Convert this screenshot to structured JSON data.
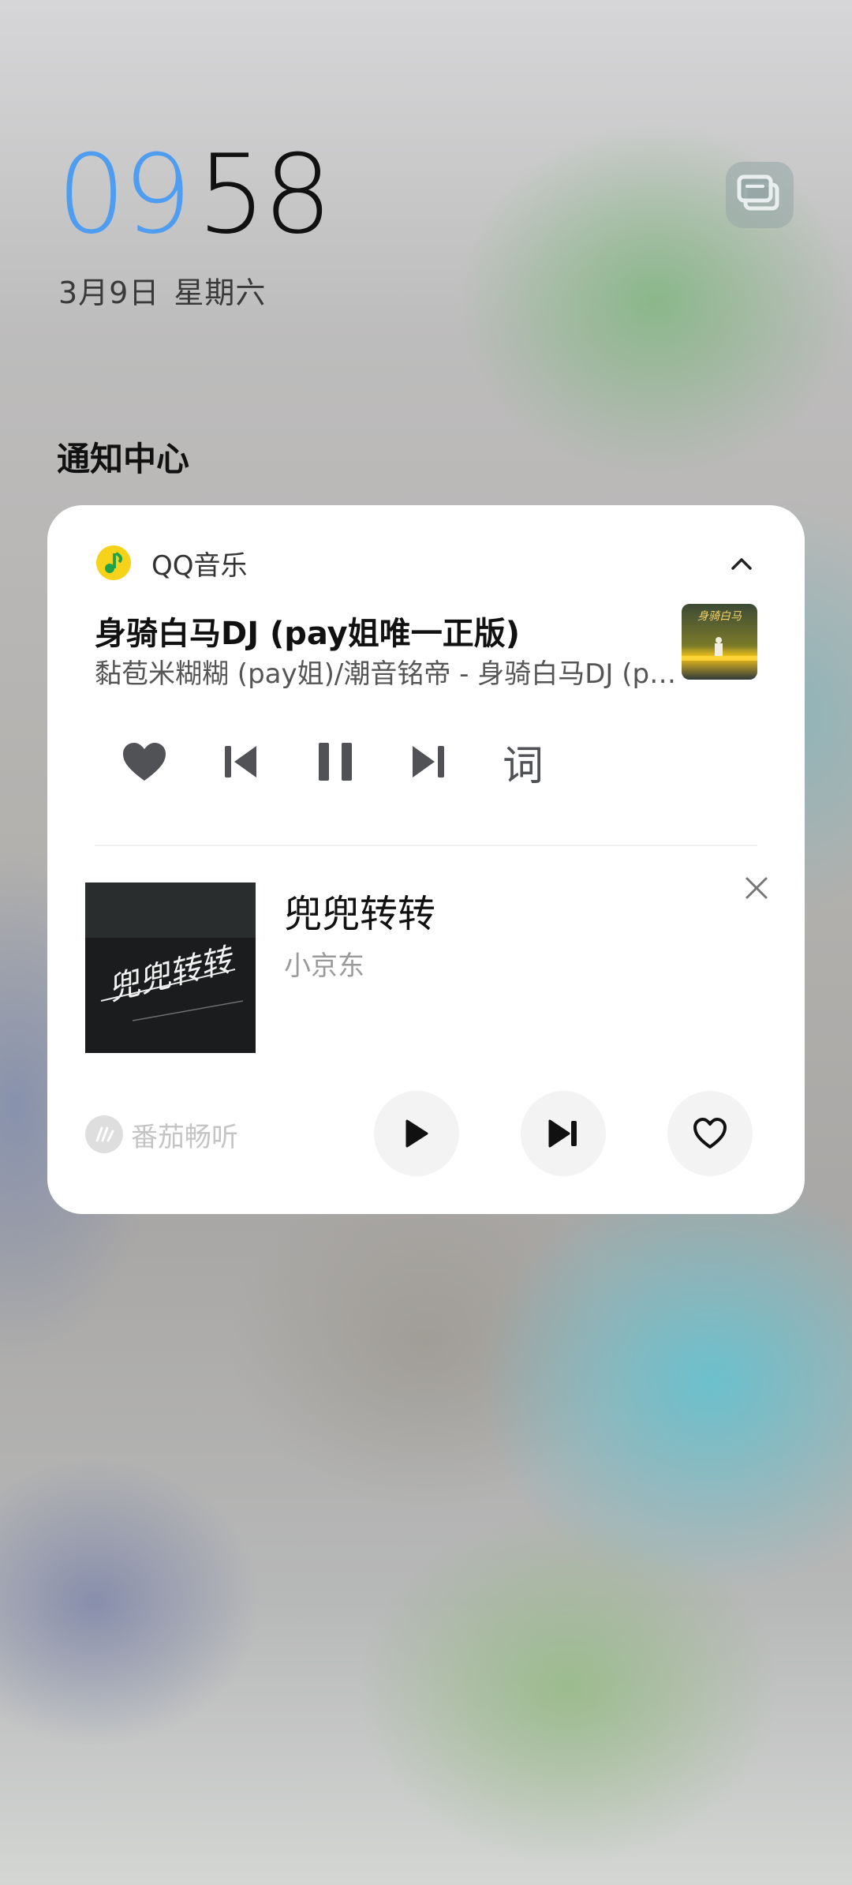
{
  "lockscreen": {
    "time_hour": "09",
    "time_minute": "58",
    "date": "3月9日",
    "weekday": "星期六"
  },
  "notification_center": {
    "title": "通知中心"
  },
  "qq_music": {
    "app_name": "QQ音乐",
    "song_title": "身骑白马DJ (pay姐唯一正版)",
    "song_subtitle": "黏苞米糊糊 (pay姐)/潮音铭帝 - 身骑白马DJ (pay姐唯一正版)",
    "lyrics_label": "词",
    "album_art_text": "身骑白马",
    "icons": {
      "app": "qq-music-note-icon",
      "collapse": "chevron-up-icon",
      "like": "heart-icon",
      "prev": "previous-track-icon",
      "pause": "pause-icon",
      "next": "next-track-icon"
    },
    "brand_color": "#f6d21b"
  },
  "fanqie": {
    "song_title": "兜兜转转",
    "artist": "小京东",
    "brand_name": "番茄畅听",
    "cover_text": "兜兜转转",
    "icons": {
      "close": "close-icon",
      "play": "play-icon",
      "next": "next-track-icon",
      "like": "heart-outline-icon",
      "brand": "fanqie-logo-icon"
    }
  },
  "colors": {
    "clock_hour": "#4f9df0",
    "clock_minute": "#111111",
    "card_bg": "#ffffff"
  }
}
